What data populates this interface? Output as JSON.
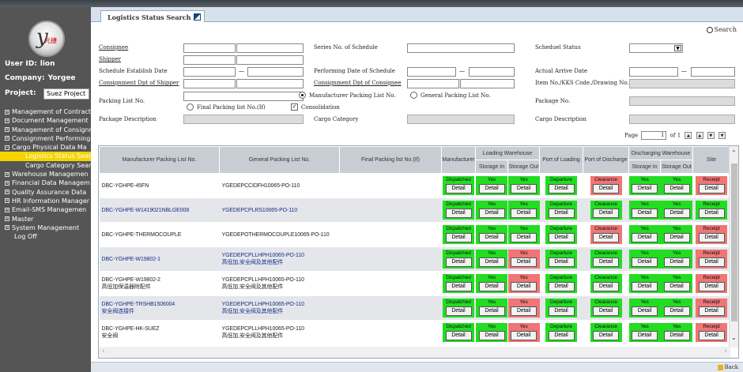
{
  "sidebar": {
    "user_label": "User ID:",
    "user_value": "lion",
    "company_label": "Company:",
    "company_value": "Yorgee",
    "project_label": "Project:",
    "project_value": "Suez Project",
    "logo_text": "元捷",
    "items": [
      {
        "label": "Management of Contract",
        "kind": "group"
      },
      {
        "label": "Document Management",
        "kind": "group"
      },
      {
        "label": "Management of Consignm",
        "kind": "group"
      },
      {
        "label": "Consignment Performing",
        "kind": "group"
      },
      {
        "label": "Cargo Physical Data Ma",
        "kind": "group-open"
      },
      {
        "label": "Logistics Status Sear",
        "kind": "sub-active"
      },
      {
        "label": "Cargo Category Sear",
        "kind": "sub"
      },
      {
        "label": "Warehouse Managemen",
        "kind": "group"
      },
      {
        "label": "Financial Data Managem",
        "kind": "group"
      },
      {
        "label": "Quality Assurance Data",
        "kind": "group"
      },
      {
        "label": "HR Information Manager",
        "kind": "group"
      },
      {
        "label": "Email-SMS Managemen",
        "kind": "group"
      },
      {
        "label": "Master",
        "kind": "group"
      },
      {
        "label": "System Management",
        "kind": "group"
      },
      {
        "label": "Log Off",
        "kind": "plain"
      }
    ]
  },
  "tab": {
    "label": "Logistics Status Search"
  },
  "search_label": "Search",
  "form": {
    "consignee": "Consignee",
    "shipper": "Shipper",
    "schedule_establish_date": "Schedule Establish Date",
    "consignment_dpt_shipper": "Consignment Dpt of Shipper",
    "packing_list_no": "Packing List No.",
    "package_description": "Package Description",
    "series_no_schedule": "Series No. of Schedule",
    "performing_date_schedule": "Performing Date of Schedule",
    "consignment_dpt_consignee": "Consignment Dpt of Consignee",
    "manufacturer_packing_list": "Manufacturer Packing List No.",
    "general_packing_list": "General Packing List No.",
    "final_packing_list": "Final Packing list No.(If)",
    "consolidation": "Consolidation",
    "cargo_category": "Cargo Category",
    "scheduel_status": "Scheduel Status",
    "actual_arrive_date": "Actual Arrive Date",
    "item_no": "Item No./KKS Code./Drawing No.",
    "package_no": "Package No.",
    "cargo_description": "Cargo Description"
  },
  "pager": {
    "label": "Page",
    "current": "1",
    "of": "of 1"
  },
  "table": {
    "headers": {
      "mpl": "Manufacturer Packing List No.",
      "gpl": "General Packing List No.",
      "fpl": "Final Packing list No.(If)",
      "manufacturer": "Manufacturer",
      "loading_wh": "Loading Warehouse",
      "storage_in": "Storage In",
      "storage_out": "Storage Out",
      "port_loading": "Port of Loading",
      "port_discharge": "Port of Discharge",
      "discharging_wh": "Discharging Warehouse",
      "d_storage_in": "Storage In",
      "d_storage_out": "Storage Out",
      "site": "Site"
    },
    "detail_label": "Detail",
    "rows": [
      {
        "mpl": [
          "DBC-YGHPE-45FN"
        ],
        "gpl": [
          "YGEDEPCCIDFH10065-PO-110"
        ],
        "link": false,
        "status": [
          [
            "Dispatched",
            "g"
          ],
          [
            "Yes",
            "g"
          ],
          [
            "Yes",
            "g"
          ],
          [
            "Departure",
            "g"
          ],
          [
            "Clearance",
            "r"
          ],
          [
            "Yes",
            "g"
          ],
          [
            "Yes",
            "g"
          ],
          [
            "Receipt",
            "r"
          ]
        ]
      },
      {
        "mpl": [
          "DBC-YGHPE-W1419021NBLGE008"
        ],
        "gpl": [
          "YGEDEPCPLRS10065-PO-110"
        ],
        "link": true,
        "status": [
          [
            "Dispatched",
            "g"
          ],
          [
            "Yes",
            "g"
          ],
          [
            "Yes",
            "g"
          ],
          [
            "Departure",
            "g"
          ],
          [
            "Clearance",
            "g"
          ],
          [
            "Yes",
            "g"
          ],
          [
            "Yes",
            "g"
          ],
          [
            "Receipt",
            "g"
          ]
        ]
      },
      {
        "mpl": [
          "DBC-YGHPE-THERMOCOUPLE"
        ],
        "gpl": [
          "YGEDEPOTHERMOCOUPLE10065-PO-110"
        ],
        "link": false,
        "status": [
          [
            "Dispatched",
            "g"
          ],
          [
            "Yes",
            "g"
          ],
          [
            "Yes",
            "g"
          ],
          [
            "Departure",
            "g"
          ],
          [
            "Clearance",
            "r"
          ],
          [
            "Yes",
            "g"
          ],
          [
            "Yes",
            "g"
          ],
          [
            "Receipt",
            "r"
          ]
        ]
      },
      {
        "mpl": [
          "DBC-YGHPE-W19802-1"
        ],
        "gpl": [
          "YGEDEPCPLLHPH10065-PO-110",
          "高低加,安全阀及其他配件"
        ],
        "link": true,
        "status": [
          [
            "Dispatched",
            "g"
          ],
          [
            "Yes",
            "g"
          ],
          [
            "Yes",
            "r"
          ],
          [
            "Departure",
            "g"
          ],
          [
            "Clearance",
            "g"
          ],
          [
            "Yes",
            "g"
          ],
          [
            "Yes",
            "g"
          ],
          [
            "Receipt",
            "r"
          ]
        ]
      },
      {
        "mpl": [
          "DBC-YGHPE-W19802-2",
          "高低加保温器附配件"
        ],
        "gpl": [
          "YGEDEPCPLLHPH10065-PO-110",
          "高低加,安全阀及其他配件"
        ],
        "link": false,
        "status": [
          [
            "Dispatched",
            "g"
          ],
          [
            "Yes",
            "g"
          ],
          [
            "Yes",
            "r"
          ],
          [
            "Departure",
            "g"
          ],
          [
            "Clearance",
            "g"
          ],
          [
            "Yes",
            "g"
          ],
          [
            "Yes",
            "g"
          ],
          [
            "Receipt",
            "r"
          ]
        ]
      },
      {
        "mpl": [
          "DBC-YGHPE-TRSHB1506004",
          "安全阀连接件"
        ],
        "gpl": [
          "YGEDEPCPLLHPH10065-PO-110",
          "高低加,安全阀及其他配件"
        ],
        "link": true,
        "status": [
          [
            "Dispatched",
            "g"
          ],
          [
            "Yes",
            "g"
          ],
          [
            "Yes",
            "r"
          ],
          [
            "Departure",
            "g"
          ],
          [
            "Clearance",
            "g"
          ],
          [
            "Yes",
            "g"
          ],
          [
            "Yes",
            "g"
          ],
          [
            "Receipt",
            "r"
          ]
        ]
      },
      {
        "mpl": [
          "DBC-YGHPE-HK-SUEZ",
          "安全阀"
        ],
        "gpl": [
          "YGEDEPCPLLHPH10065-PO-110",
          "高低加,安全阀及其他配件"
        ],
        "link": false,
        "status": [
          [
            "Dispatched",
            "g"
          ],
          [
            "Yes",
            "g"
          ],
          [
            "Yes",
            "r"
          ],
          [
            "Departure",
            "g"
          ],
          [
            "Clearance",
            "g"
          ],
          [
            "Yes",
            "g"
          ],
          [
            "Yes",
            "g"
          ],
          [
            "Receipt",
            "r"
          ]
        ]
      }
    ]
  },
  "back_label": "Back",
  "colors": {
    "green": "#22dd22",
    "red": "#f07575",
    "sidebar": "#555555",
    "active": "#f5d400"
  }
}
